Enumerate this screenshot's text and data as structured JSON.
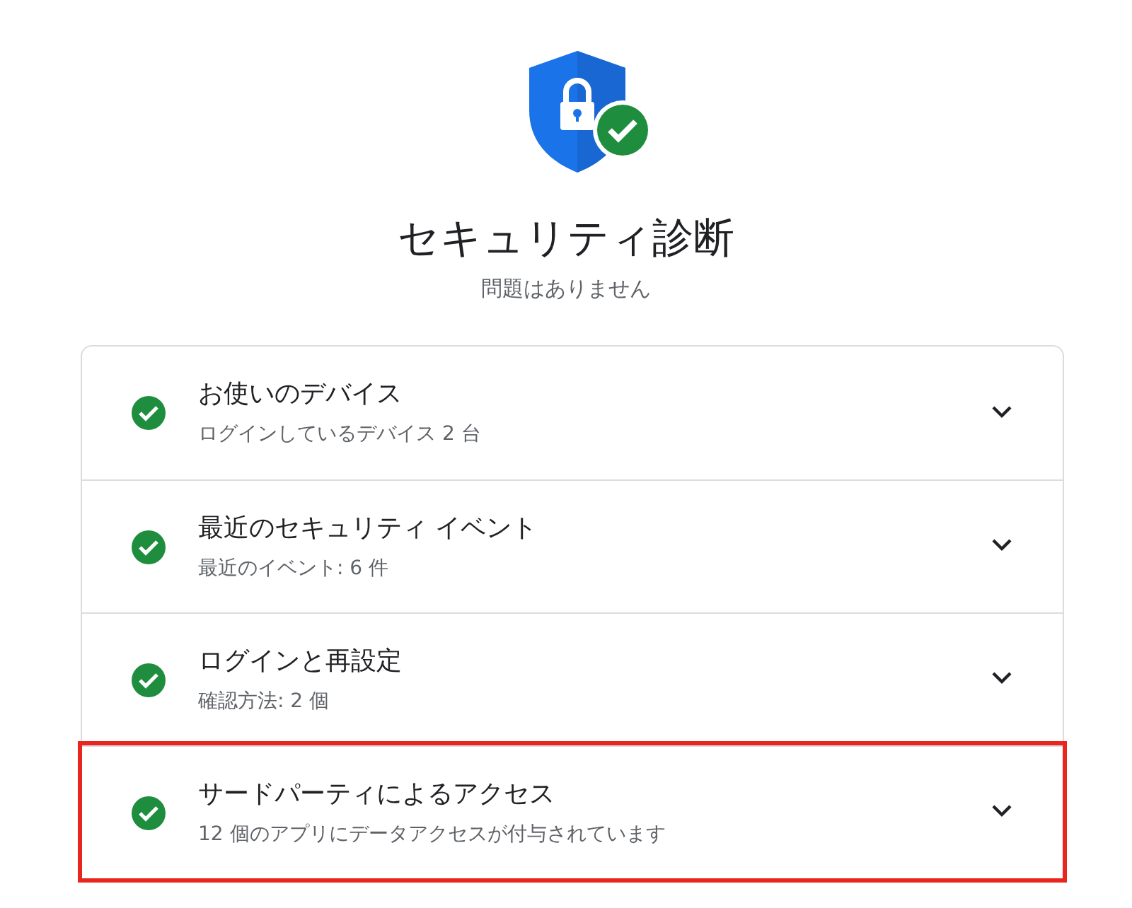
{
  "header": {
    "title": "セキュリティ診断",
    "subtitle": "問題はありません"
  },
  "items": [
    {
      "title": "お使いのデバイス",
      "detail": "ログインしているデバイス 2 台",
      "ok": true,
      "expanded": false,
      "highlighted": false
    },
    {
      "title": "最近のセキュリティ イベント",
      "detail": "最近のイベント: 6 件",
      "ok": true,
      "expanded": false,
      "highlighted": false
    },
    {
      "title": "ログインと再設定",
      "detail": "確認方法: 2 個",
      "ok": true,
      "expanded": false,
      "highlighted": false
    },
    {
      "title": "サードパーティによるアクセス",
      "detail": "12 個のアプリにデータアクセスが付与されています",
      "ok": true,
      "expanded": false,
      "highlighted": true
    }
  ]
}
